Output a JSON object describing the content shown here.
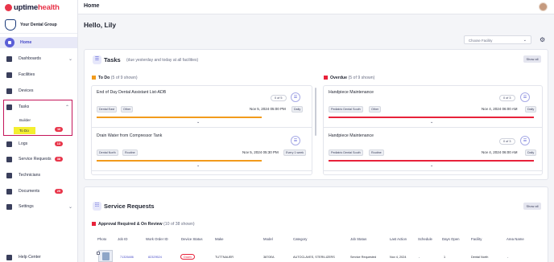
{
  "logo": {
    "prefix": "uptime",
    "suffix": "health"
  },
  "org": {
    "name": "Your Dental Group"
  },
  "sidebar": {
    "home": "Home",
    "dashboards": "Dashboards",
    "facilities": "Facilities",
    "devices": "Devices",
    "tasks": "Tasks",
    "builder": "Builder",
    "todo": "To Do",
    "todo_badge": "16",
    "logs": "Logs",
    "logs_badge": "13",
    "service_requests": "Service Requests",
    "service_requests_badge": "38",
    "technicians": "Technicians",
    "documents": "Documents",
    "documents_badge": "25",
    "settings": "Settings",
    "help": "Help Center"
  },
  "header": {
    "title": "Home"
  },
  "greeting": "Hello, Lily",
  "facility_select": {
    "placeholder": "Choose Facility"
  },
  "tasks": {
    "title": "Tasks",
    "subtitle": "(due yesterday and today at all facilities)",
    "show_all": "Show all",
    "todo": {
      "label": "To Do",
      "count": "(5 of 9 shown)",
      "cards": [
        {
          "title": "End of Day Dental Assistant List-ADB",
          "progress": "0 of 5",
          "tags": [
            "Dental East",
            "Other"
          ],
          "due": "Nov 5, 2024  05:00 PM",
          "freq": "Daily"
        },
        {
          "title": "Drain Water from Compressor Tank",
          "progress": "",
          "tags": [
            "Dental North",
            "Routine"
          ],
          "due": "Nov 5, 2024  05:30 PM",
          "freq": "Every 1 week"
        }
      ]
    },
    "overdue": {
      "label": "Overdue",
      "count": "(5 of 9 shown)",
      "cards": [
        {
          "title": "Handpiece Maintenance",
          "progress": "0 of 3",
          "tags": [
            "Pediatric Dental South",
            "Other"
          ],
          "due": "Nov 4, 2024  06:00 AM",
          "freq": "Daily"
        },
        {
          "title": "Handpiece Maintenance",
          "progress": "0 of 3",
          "tags": [
            "Pediatric Dental South",
            "Routine"
          ],
          "due": "Nov 4, 2024  06:00 AM",
          "freq": "Daily"
        }
      ]
    }
  },
  "service_requests": {
    "title": "Service Requests",
    "show_all": "Show all",
    "section_label": "Approval Required & On Review",
    "section_count": "(10 of 38 shown)",
    "columns": [
      "Photo",
      "Job ID",
      "Work Order ID",
      "Device Status",
      "Make",
      "Model",
      "Category",
      "Job Status",
      "Last Action",
      "Schedule",
      "Days Open",
      "Facility",
      "Area Name"
    ],
    "rows": [
      {
        "job_id": "71326486",
        "work_order_id": "82329524",
        "device_status": "Down",
        "make": "TUTTNAUER",
        "model": "3870EA",
        "category": "AUTOCLAVES, STERILIZERS",
        "job_status": "Service Requested",
        "last_action": "Nov 4, 2024",
        "schedule": "-",
        "days_open": "1",
        "facility": "Dental North",
        "area_name": "-"
      }
    ]
  },
  "colors": {
    "accent": "#5b5fd6",
    "brand": "#e8354a",
    "todo_flag": "#f29b1c",
    "overdue_flag": "#e8223a",
    "highlight_box": "#c4155a"
  }
}
